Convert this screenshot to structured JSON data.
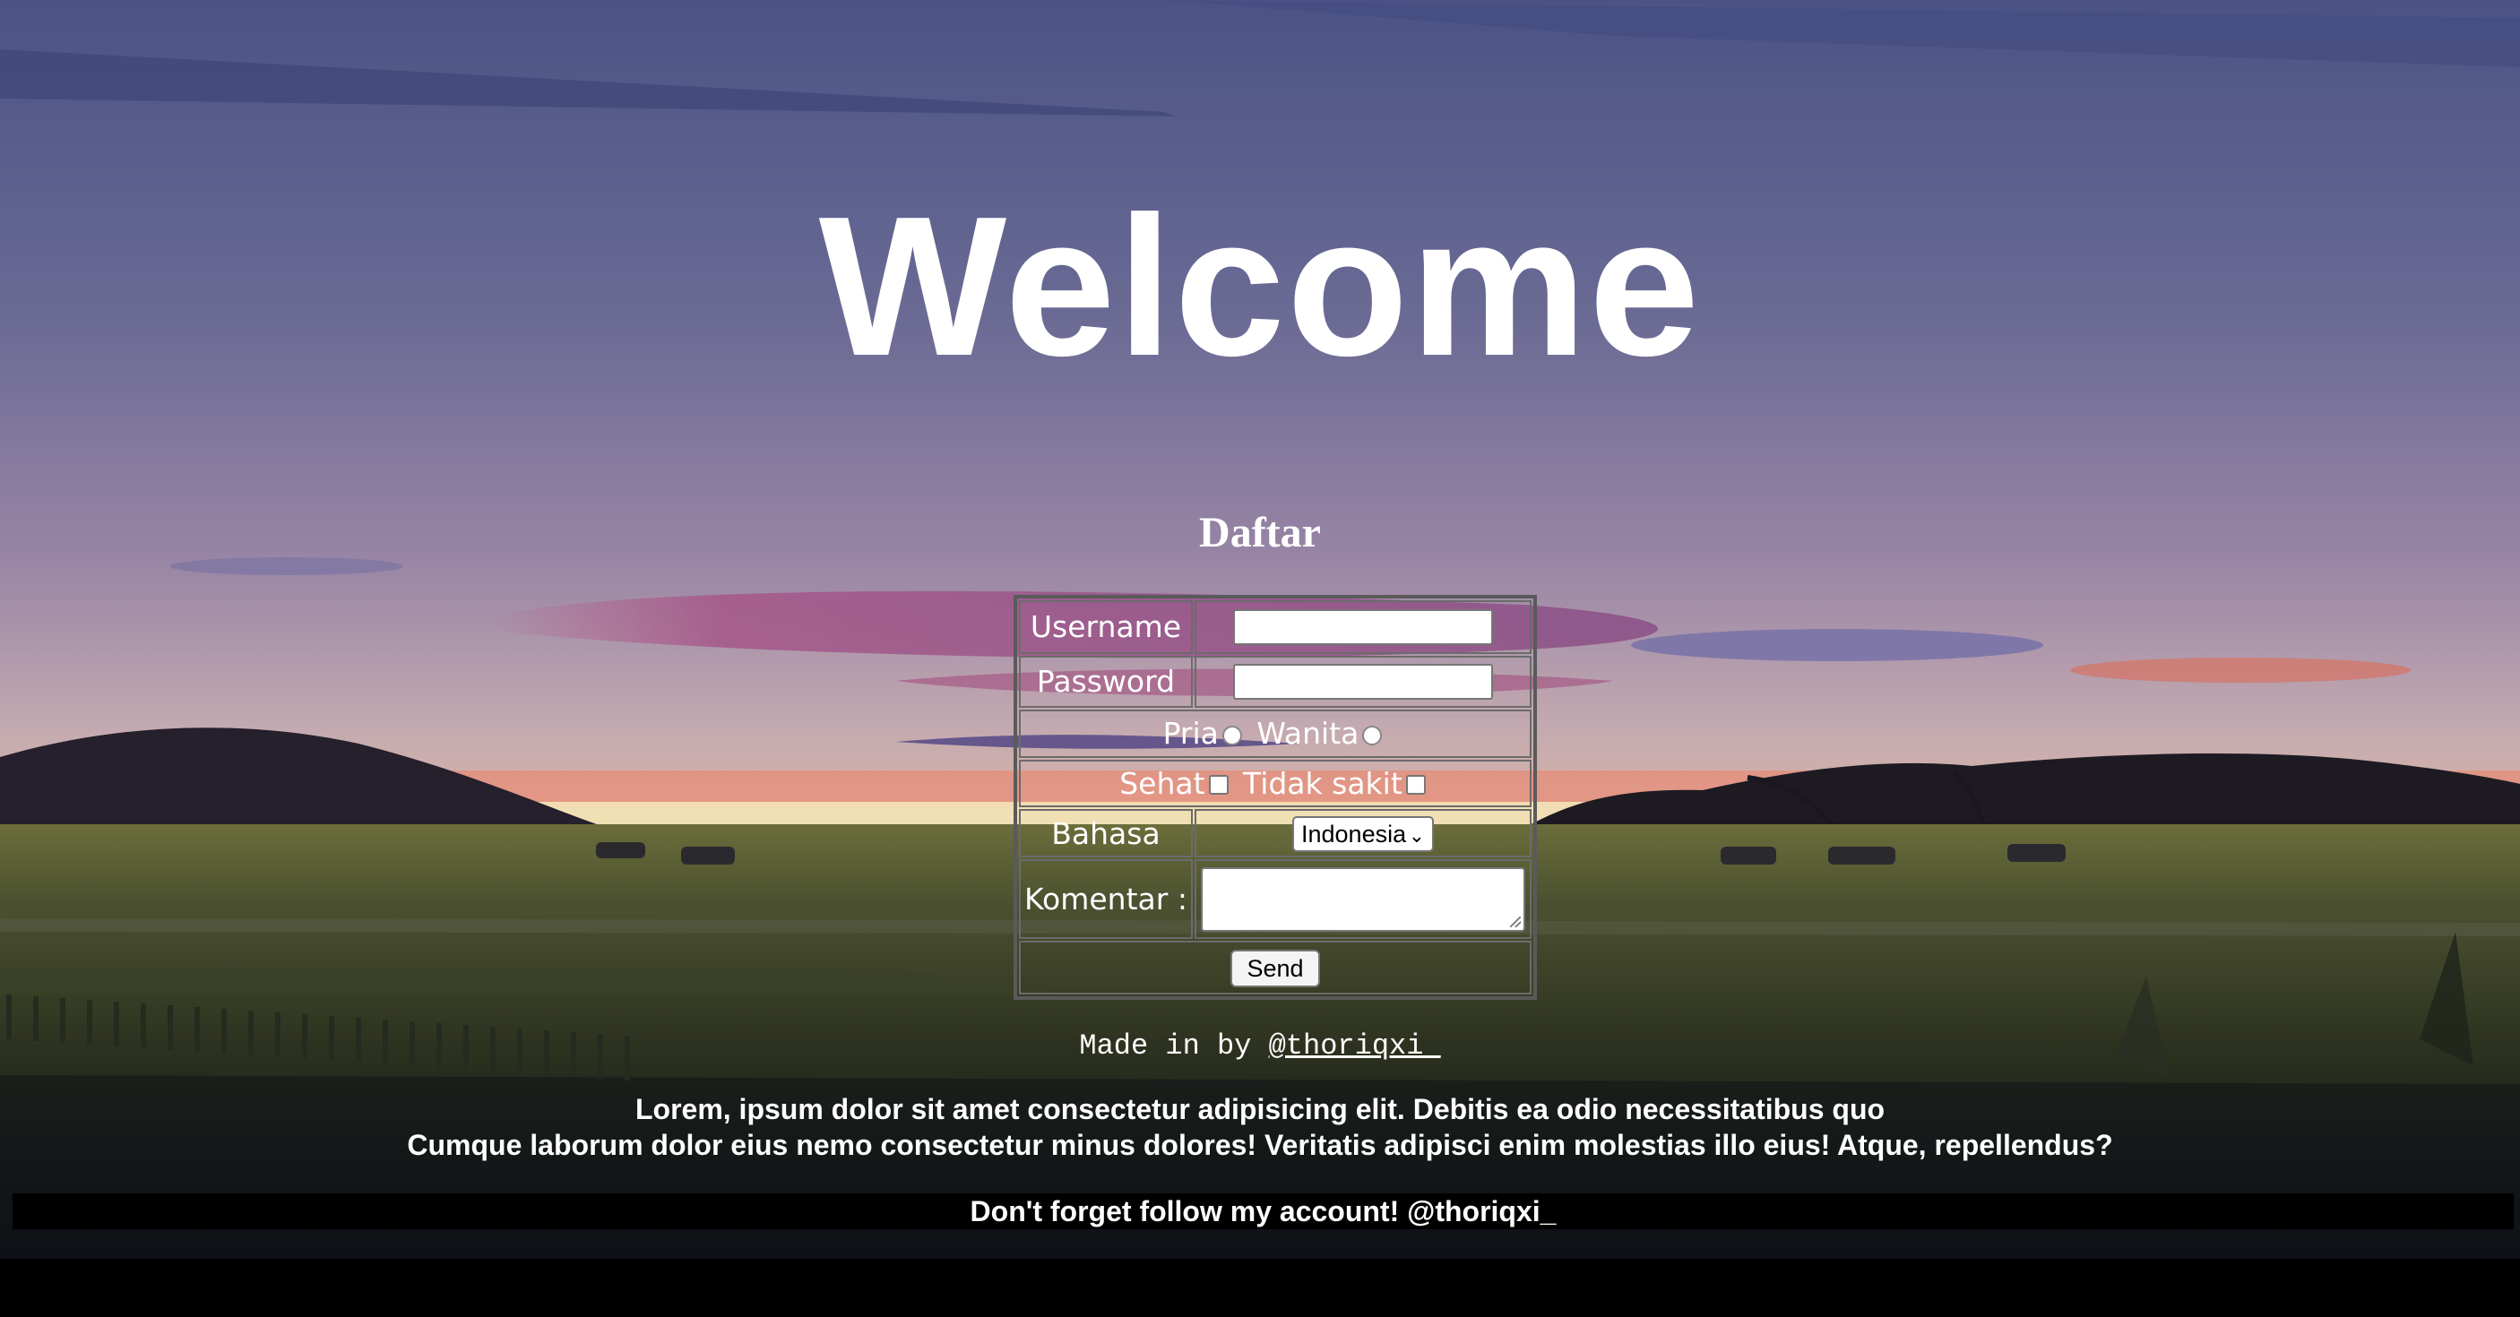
{
  "header": {
    "title": "Welcome"
  },
  "form": {
    "heading": "Daftar",
    "username_label": "Username",
    "username_value": "",
    "password_label": "Password",
    "password_value": "",
    "gender_options": [
      "Pria",
      "Wanita"
    ],
    "health_options": [
      "Sehat",
      "Tidak sakit"
    ],
    "language_label": "Bahasa",
    "language_selected": "Indonesia",
    "comment_label": "Komentar :",
    "comment_value": "",
    "send_label": "Send"
  },
  "credit": {
    "prefix": "Made in by",
    "link": "@thoriqxi_"
  },
  "lorem": {
    "line1": "Lorem, ipsum dolor sit amet consectetur adipisicing elit. Debitis ea odio necessitatibus quo",
    "line2": "Cumque laborum dolor eius nemo consectetur minus dolores! Veritatis adipisci enim molestias illo eius! Atque, repellendus?"
  },
  "footer": {
    "text": "Don't forget follow my account! @thoriqxi_"
  },
  "colors": {
    "sky_top": "#4b5385",
    "sky_mid": "#8d7aa0",
    "horizon": "#e8826b",
    "grass": "#3a4224",
    "bottom": "#000000"
  }
}
